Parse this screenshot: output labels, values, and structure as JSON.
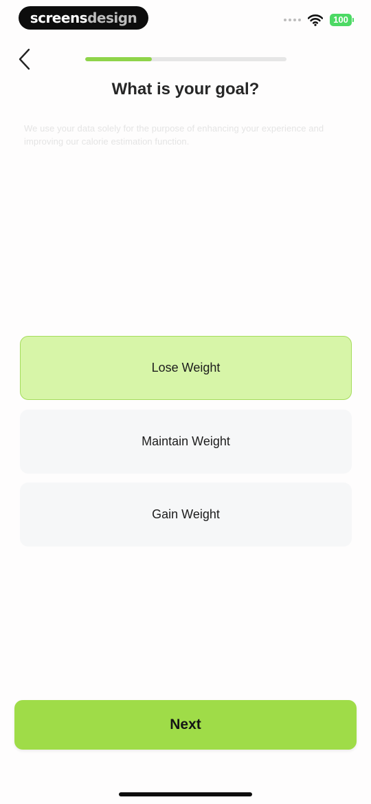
{
  "status_bar": {
    "brand_part1": "screens",
    "brand_part2": "design",
    "battery": "100"
  },
  "progress": {
    "fraction": 0.33
  },
  "header": {
    "title": "What is your goal?",
    "subtitle": "We use your data solely for the purpose of enhancing your experience and improving our calorie estimation function."
  },
  "options": [
    {
      "label": "Lose Weight",
      "selected": true
    },
    {
      "label": "Maintain Weight",
      "selected": false
    },
    {
      "label": "Gain Weight",
      "selected": false
    }
  ],
  "footer": {
    "next_label": "Next"
  },
  "colors": {
    "accent": "#9fdc48",
    "selected_bg": "#d7f5a8",
    "battery": "#4cd964"
  }
}
